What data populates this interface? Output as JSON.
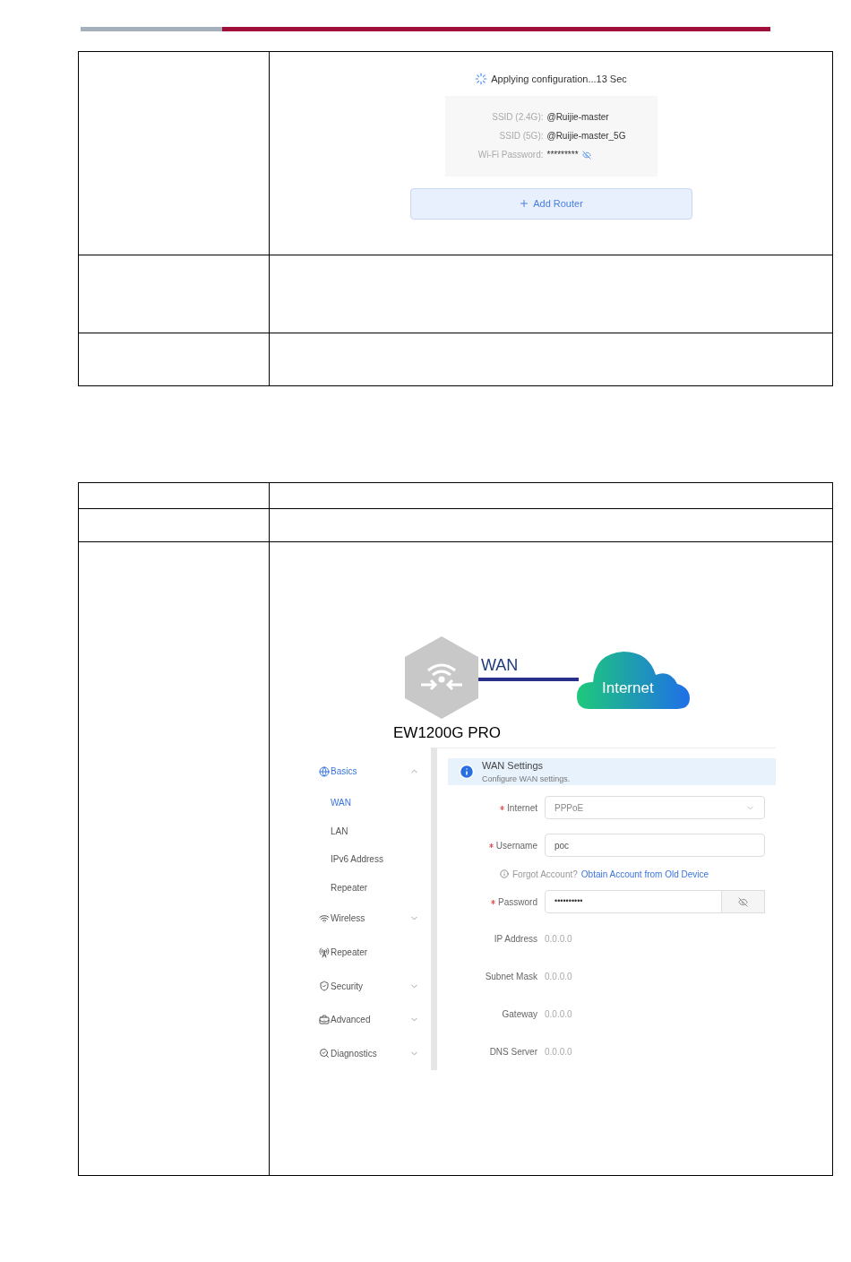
{
  "apply_screen": {
    "status": "Applying configuration...13 Sec",
    "fields": [
      {
        "label": "SSID (2.4G):",
        "value": "@Ruijie-master",
        "kind": "text"
      },
      {
        "label": "SSID (5G):",
        "value": "@Ruijie-master_5G",
        "kind": "text"
      },
      {
        "label": "Wi-Fi Password:",
        "value": "*********",
        "kind": "secret"
      }
    ],
    "button": "Add Router"
  },
  "wan_screen": {
    "diagram": {
      "wan_label": "WAN",
      "cloud_label": "Internet",
      "device_name": "EW1200G PRO"
    },
    "sidebar": [
      {
        "label": "Basics",
        "selected": true,
        "expanded": true,
        "children": [
          {
            "label": "WAN",
            "selected": true
          },
          {
            "label": "LAN",
            "selected": false
          },
          {
            "label": "IPv6 Address",
            "selected": false
          },
          {
            "label": "Repeater",
            "selected": false
          }
        ]
      },
      {
        "label": "Wireless",
        "selected": false,
        "expanded": false
      },
      {
        "label": "Repeater",
        "selected": false
      },
      {
        "label": "Security",
        "selected": false,
        "expanded": false
      },
      {
        "label": "Advanced",
        "selected": false,
        "expanded": false
      },
      {
        "label": "Diagnostics",
        "selected": false,
        "expanded": false
      }
    ],
    "banner": {
      "title": "WAN Settings",
      "text": "Configure WAN settings."
    },
    "form": [
      {
        "kind": "select",
        "label": "Internet",
        "required": true,
        "value": "PPPoE"
      },
      {
        "kind": "input",
        "label": "Username",
        "required": true,
        "value": "poc"
      },
      {
        "kind": "hint",
        "text": "Forgot Account?",
        "link": "Obtain Account from Old Device"
      },
      {
        "kind": "password",
        "label": "Password",
        "required": true,
        "value": "••••••••••"
      },
      {
        "kind": "static",
        "label": "IP Address",
        "required": false,
        "value": "0.0.0.0"
      },
      {
        "kind": "static",
        "label": "Subnet Mask",
        "required": false,
        "value": "0.0.0.0"
      },
      {
        "kind": "static",
        "label": "Gateway",
        "required": false,
        "value": "0.0.0.0"
      },
      {
        "kind": "static",
        "label": "DNS Server",
        "required": false,
        "value": "0.0.0.0"
      }
    ]
  }
}
